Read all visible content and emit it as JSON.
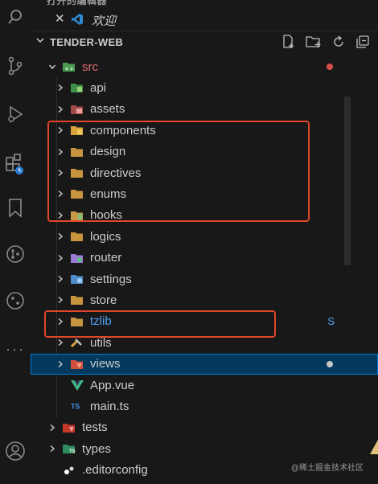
{
  "open_editors": {
    "header_partial": "打开的编辑器",
    "item_label": "欢迎"
  },
  "explorer": {
    "project_title": "TENDER-WEB",
    "actions": [
      "new-file-icon",
      "new-folder-icon",
      "refresh-icon",
      "collapse-all-icon"
    ]
  },
  "tree": [
    {
      "label": "src",
      "kind": "folder-open",
      "icon": "src-folder-icon",
      "indent": 1,
      "color": "#e06c75",
      "modified_dot": true
    },
    {
      "label": "api",
      "kind": "folder",
      "icon": "api-folder-icon",
      "indent": 2
    },
    {
      "label": "assets",
      "kind": "folder",
      "icon": "assets-folder-icon",
      "indent": 2
    },
    {
      "label": "components",
      "kind": "folder",
      "icon": "components-folder-icon",
      "indent": 2
    },
    {
      "label": "design",
      "kind": "folder",
      "icon": "folder-icon",
      "indent": 2
    },
    {
      "label": "directives",
      "kind": "folder",
      "icon": "folder-icon",
      "indent": 2
    },
    {
      "label": "enums",
      "kind": "folder",
      "icon": "folder-icon",
      "indent": 2
    },
    {
      "label": "hooks",
      "kind": "folder",
      "icon": "hooks-folder-icon",
      "indent": 2
    },
    {
      "label": "logics",
      "kind": "folder",
      "icon": "folder-icon",
      "indent": 2
    },
    {
      "label": "router",
      "kind": "folder",
      "icon": "router-folder-icon",
      "indent": 2
    },
    {
      "label": "settings",
      "kind": "folder",
      "icon": "settings-folder-icon",
      "indent": 2
    },
    {
      "label": "store",
      "kind": "folder",
      "icon": "folder-icon",
      "indent": 2
    },
    {
      "label": "tzlib",
      "kind": "folder",
      "icon": "folder-icon",
      "indent": 2,
      "color": "#4fa3f7",
      "badge": "S"
    },
    {
      "label": "utils",
      "kind": "folder",
      "icon": "utils-folder-icon",
      "indent": 2
    },
    {
      "label": "views",
      "kind": "folder",
      "icon": "views-folder-icon",
      "indent": 2,
      "selected": true,
      "modified_dot": true
    },
    {
      "label": "App.vue",
      "kind": "file",
      "icon": "vue-file-icon",
      "indent": 2
    },
    {
      "label": "main.ts",
      "kind": "file",
      "icon": "ts-file-icon",
      "indent": 2
    },
    {
      "label": "tests",
      "kind": "folder",
      "icon": "tests-folder-icon",
      "indent": 1
    },
    {
      "label": "types",
      "kind": "folder",
      "icon": "types-folder-icon",
      "indent": 1
    },
    {
      "label": ".editorconfig",
      "kind": "file",
      "icon": "editorconfig-file-icon",
      "indent": 1
    }
  ],
  "colors": {
    "selection_bg": "#04395e",
    "selection_border": "#0078d4",
    "highlight_box": "#e0462c",
    "modified_dot": "#d6504a",
    "untracked_blue": "#4fa3f7"
  },
  "watermark": "@稀土掘金技术社区"
}
